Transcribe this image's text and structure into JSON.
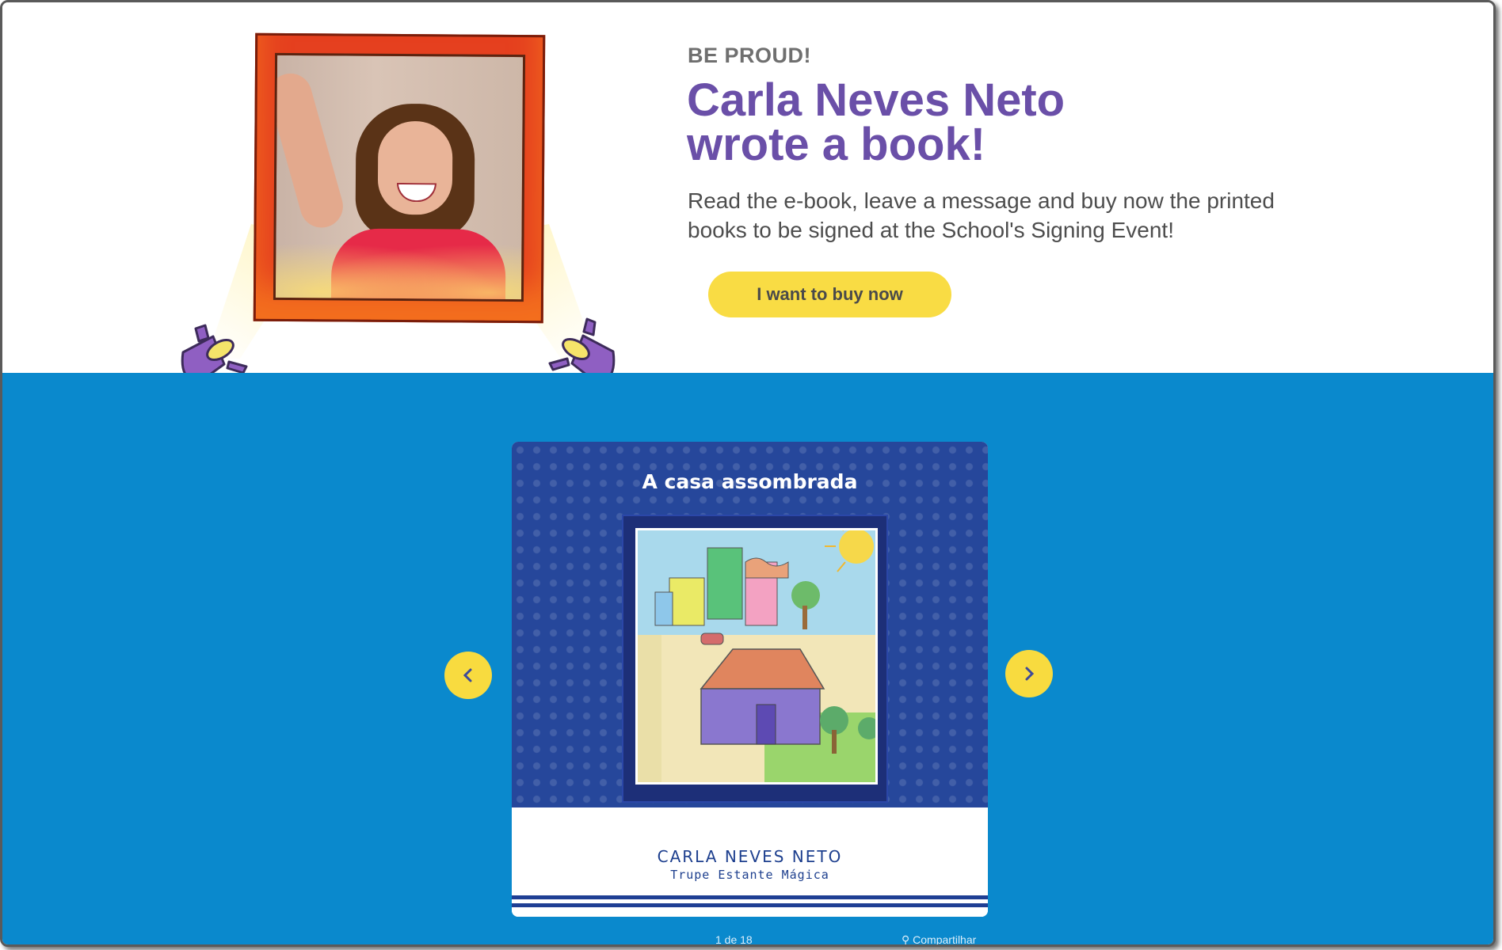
{
  "hero": {
    "eyebrow": "BE PROUD!",
    "title_line1": "Carla Neves Neto",
    "title_line2": "wrote a book!",
    "description_line1": "Read the e-book, leave a message and buy now the printed",
    "description_line2": "books to be signed at the School's Signing Event!",
    "buy_button": "I want to buy now"
  },
  "book": {
    "title": "A casa assombrada",
    "author": "CARLA NEVES NETO",
    "collection": "Trupe Estante Mágica"
  },
  "viewer": {
    "page_count": "1 de 18",
    "share_label": "Compartilhar"
  },
  "icons": {
    "prev": "chevron-left-icon",
    "next": "chevron-right-icon",
    "share": "share-icon"
  },
  "colors": {
    "title_purple": "#6a4fa8",
    "button_yellow": "#f9dc44",
    "stage_blue": "#0a89cd",
    "cover_blue": "#26479b",
    "frame_red": "#e5401f"
  }
}
